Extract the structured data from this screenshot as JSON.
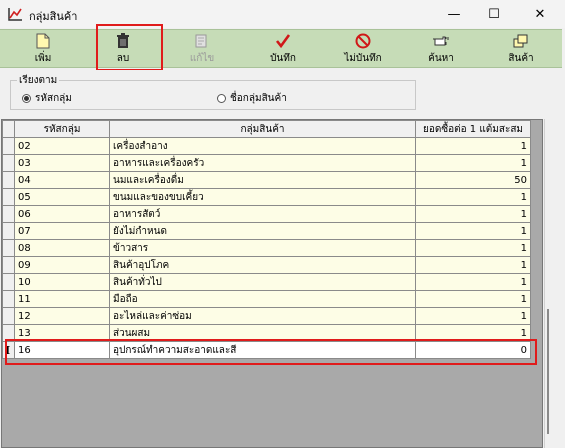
{
  "window": {
    "title": "กลุ่มสินค้า",
    "minimize": "—",
    "maximize": "☐",
    "close": "✕"
  },
  "toolbar": {
    "add": "เพิ่ม",
    "delete": "ลบ",
    "edit": "แก้ไข",
    "save": "บันทึก",
    "cancel": "ไม่บันทึก",
    "search": "ค้นหา",
    "products": "สินค้า"
  },
  "sort": {
    "legend": "เรียงตาม",
    "option_code": "รหัสกลุ่ม",
    "option_name": "ชื่อกลุ่มสินค้า",
    "selected": "code"
  },
  "grid": {
    "headers": [
      "รหัสกลุ่ม",
      "กลุ่มสินค้า",
      "ยอดซื้อต่อ 1 แต้มสะสม"
    ],
    "rows": [
      {
        "code": "02",
        "name": "เครื่องสำอาง",
        "points": "1"
      },
      {
        "code": "03",
        "name": "อาหารและเครื่องครัว",
        "points": "1"
      },
      {
        "code": "04",
        "name": "นมและเครื่องดื่ม",
        "points": "50"
      },
      {
        "code": "05",
        "name": "ขนมและของขบเคี้ยว",
        "points": "1"
      },
      {
        "code": "06",
        "name": "อาหารสัตว์",
        "points": "1"
      },
      {
        "code": "07",
        "name": "ยังไม่กำหนด",
        "points": "1"
      },
      {
        "code": "08",
        "name": "ข้าวสาร",
        "points": "1"
      },
      {
        "code": "09",
        "name": "สินค้าอุปโภค",
        "points": "1"
      },
      {
        "code": "10",
        "name": "สินค้าทั่วไป",
        "points": "1"
      },
      {
        "code": "11",
        "name": "มือถือ",
        "points": "1"
      },
      {
        "code": "12",
        "name": "อะไหล่และค่าซ่อม",
        "points": "1"
      },
      {
        "code": "13",
        "name": "ส่วนผสม",
        "points": "1"
      }
    ],
    "edit_row": {
      "indicator": "I",
      "code": "16",
      "name": "อุปกรณ์ทำความสะอาดและสี",
      "points": "0"
    }
  }
}
